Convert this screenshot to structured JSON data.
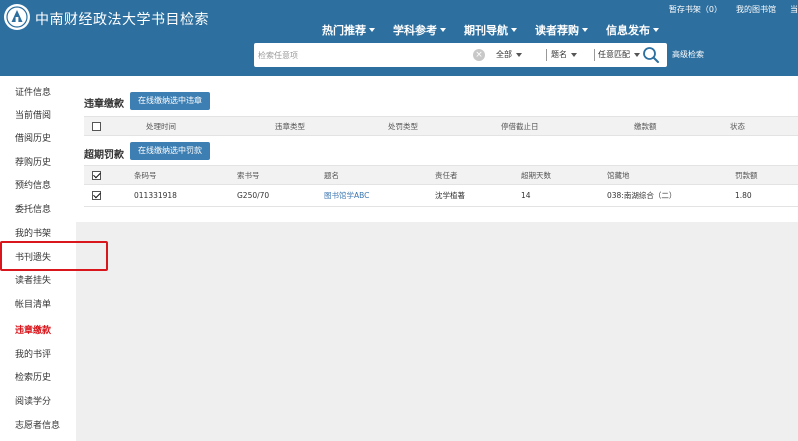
{
  "header": {
    "site_title": "中南财经政法大学书目检索",
    "top_links": [
      "暂存书架（0）",
      "我的图书馆",
      "当"
    ],
    "nav": [
      "热门推荐",
      "学科参考",
      "期刊导航",
      "读者荐购",
      "信息发布"
    ],
    "search": {
      "placeholder": "检索任意项",
      "scope": "全部",
      "field": "题名",
      "match": "任意匹配",
      "advanced": "高级检索"
    }
  },
  "sidebar": {
    "items": [
      "证件信息",
      "当前借阅",
      "借阅历史",
      "荐购历史",
      "预约信息",
      "委托信息",
      "我的书架",
      "书刊遗失",
      "读者挂失",
      "帐目清单",
      "违章缴款",
      "我的书评",
      "检索历史",
      "阅读学分",
      "志愿者信息"
    ],
    "active": "违章缴款"
  },
  "violation": {
    "title": "违章缴款",
    "pay_button": "在线缴纳选中违章",
    "columns": [
      "处理时间",
      "违章类型",
      "处罚类型",
      "停借截止日",
      "缴款额",
      "状态"
    ]
  },
  "overdue": {
    "title": "超期罚款",
    "pay_button": "在线缴纳选中罚款",
    "columns": [
      "条码号",
      "索书号",
      "题名",
      "责任者",
      "超期天数",
      "馆藏地",
      "罚款额"
    ],
    "rows": [
      {
        "barcode": "011331918",
        "callno": "G250/70",
        "title": "图书馆学ABC",
        "author": "沈学植著",
        "days": "14",
        "location": "038:南湖综合（二）",
        "fine": "1.80"
      }
    ]
  },
  "colors": {
    "header": "#2d6f9f",
    "button": "#3e7fb3",
    "active": "#d9161c",
    "link": "#3a76b0"
  }
}
